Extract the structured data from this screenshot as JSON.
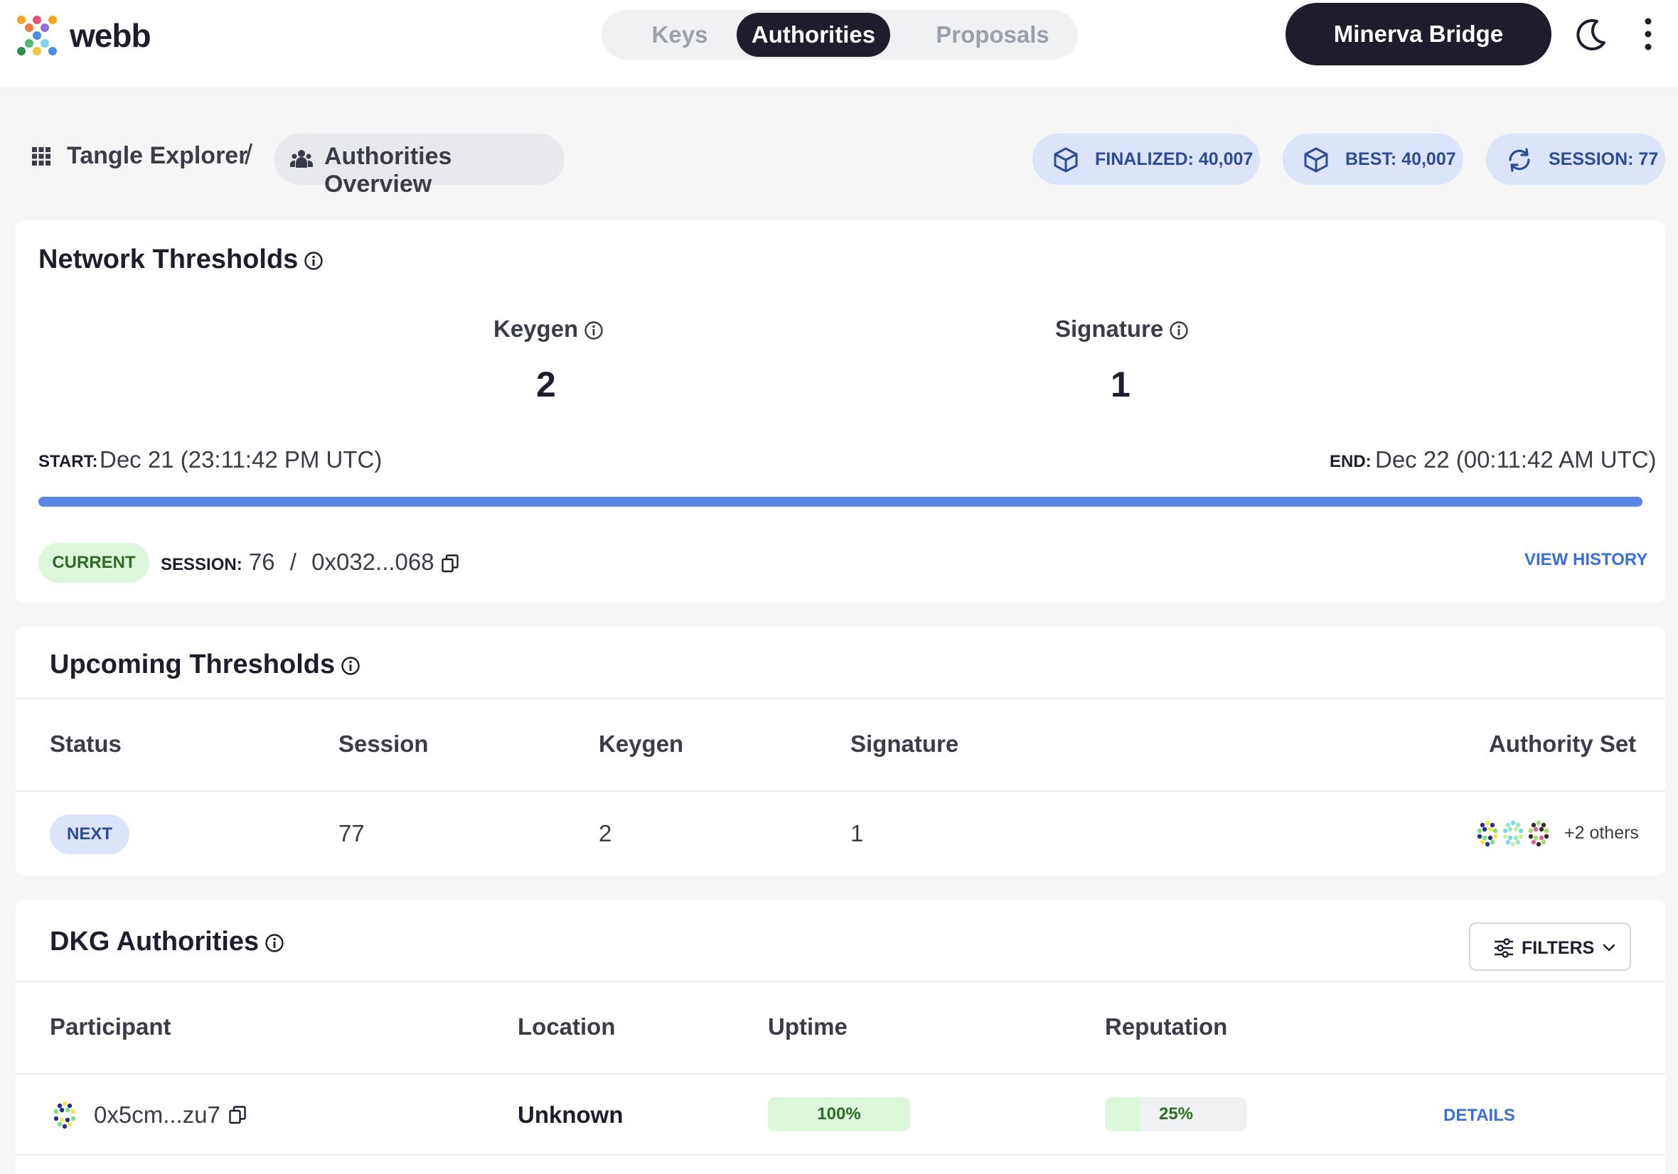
{
  "brand": {
    "name": "webb"
  },
  "nav": {
    "tabs": [
      {
        "label": "Keys",
        "active": false
      },
      {
        "label": "Authorities",
        "active": true
      },
      {
        "label": "Proposals",
        "active": false
      }
    ]
  },
  "header": {
    "network_button": "Minerva Bridge",
    "theme_icon": "moon-icon",
    "menu_icon": "more-vertical-icon"
  },
  "breadcrumb": {
    "root": "Tangle Explorer",
    "separator": "/",
    "current": "Authorities Overview"
  },
  "stats": {
    "finalized": "FINALIZED: 40,007",
    "best": "BEST: 40,007",
    "session": "SESSION: 77"
  },
  "network_thresholds": {
    "title": "Network Thresholds",
    "keygen_label": "Keygen",
    "keygen_value": "2",
    "signature_label": "Signature",
    "signature_value": "1",
    "start_label": "START:",
    "start_value": "Dec 21 (23:11:42 PM UTC)",
    "end_label": "END:",
    "end_value": "Dec 22 (00:11:42 AM UTC)",
    "progress_percent": 100,
    "status_pill": "CURRENT",
    "session_label": "SESSION:",
    "session_value": "76",
    "session_sep": "/",
    "session_key": "0x032...068",
    "view_history": "VIEW HISTORY"
  },
  "upcoming_thresholds": {
    "title": "Upcoming Thresholds",
    "columns": [
      "Status",
      "Session",
      "Keygen",
      "Signature",
      "Authority Set"
    ],
    "rows": [
      {
        "status": "NEXT",
        "session": "77",
        "keygen": "2",
        "signature": "1",
        "authority_set_more": "+2 others"
      }
    ]
  },
  "dkg_authorities": {
    "title": "DKG Authorities",
    "filters_label": "FILTERS",
    "columns": [
      "Participant",
      "Location",
      "Uptime",
      "Reputation"
    ],
    "rows": [
      {
        "participant": "0x5cm...zu7",
        "location": "Unknown",
        "uptime": "100%",
        "uptime_value": 100,
        "reputation": "25%",
        "reputation_value": 25,
        "action": "DETAILS"
      }
    ]
  },
  "colors": {
    "accent": "#5b86e5",
    "dark": "#1f1d2b",
    "chip_bg": "#dbe4f8",
    "success_bg": "#ddf7dc",
    "success_text": "#2e6b23",
    "link": "#3a6fd8"
  }
}
